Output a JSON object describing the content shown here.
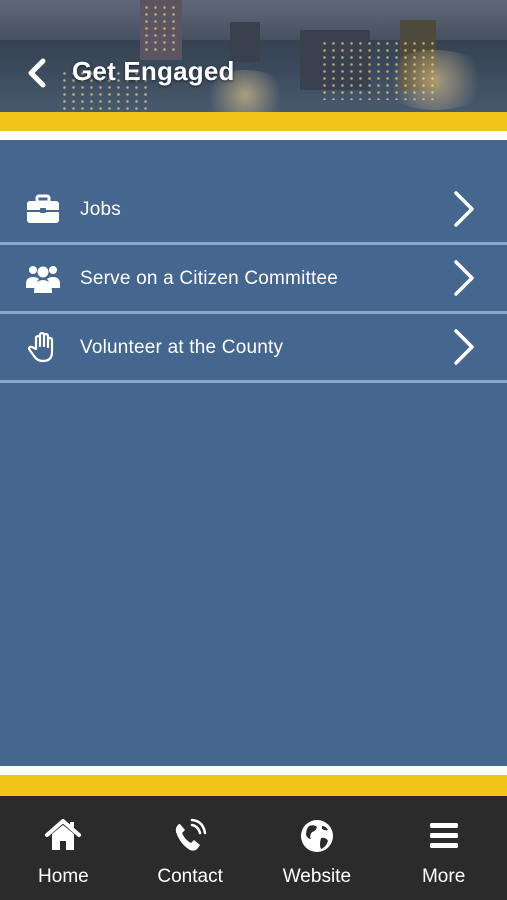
{
  "header": {
    "title": "Get Engaged",
    "back_icon": "chevron-left-icon"
  },
  "colors": {
    "background": "#44668f",
    "accent_gold": "#f0c419",
    "divider": "#8aa8cc",
    "tabbar": "#2b2b2b"
  },
  "menu": {
    "items": [
      {
        "label": "Jobs",
        "icon": "briefcase-icon"
      },
      {
        "label": "Serve on a Citizen Committee",
        "icon": "group-icon"
      },
      {
        "label": "Volunteer at the County",
        "icon": "hand-icon"
      }
    ]
  },
  "tabs": [
    {
      "label": "Home",
      "icon": "home-icon"
    },
    {
      "label": "Contact",
      "icon": "phone-icon"
    },
    {
      "label": "Website",
      "icon": "globe-icon"
    },
    {
      "label": "More",
      "icon": "menu-icon"
    }
  ]
}
